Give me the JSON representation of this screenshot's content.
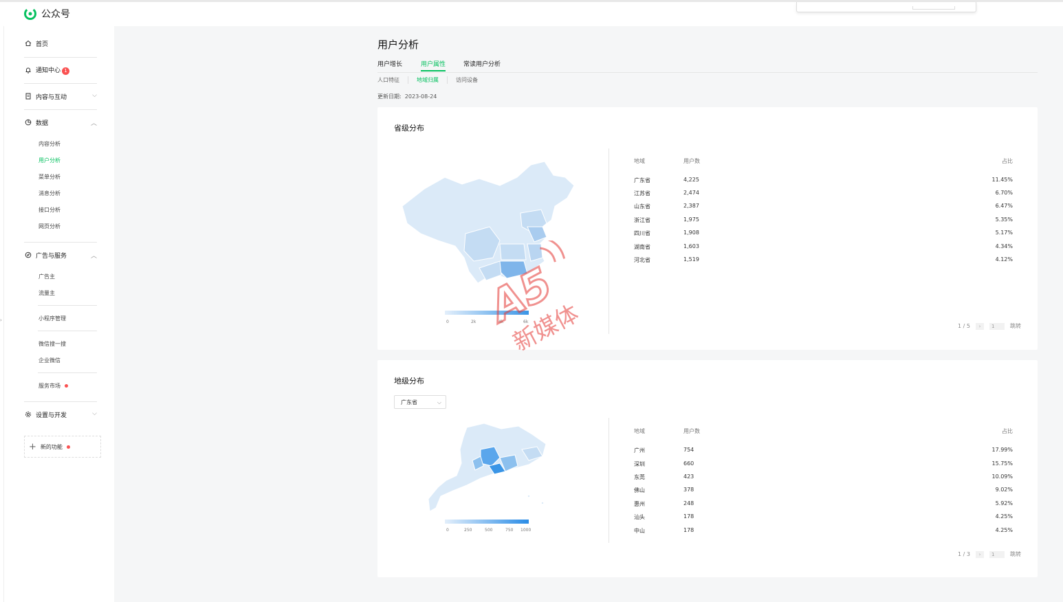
{
  "app": {
    "name": "公众号"
  },
  "sidebar": {
    "home": "首页",
    "notify": "通知中心",
    "notify_badge": "1",
    "content": "内容与互动",
    "data": "数据",
    "data_items": [
      "内容分析",
      "用户分析",
      "菜单分析",
      "消息分析",
      "接口分析",
      "网页分析"
    ],
    "data_active": "用户分析",
    "ads": "广告与服务",
    "ads_items": [
      "广告主",
      "流量主"
    ],
    "mini": "小程序管理",
    "search": "微信搜一搜",
    "wework": "企业微信",
    "market": "服务市场",
    "settings": "设置与开发",
    "newfunc": "新的功能"
  },
  "page": {
    "title": "用户分析",
    "tabs": [
      "用户增长",
      "用户属性",
      "常读用户分析"
    ],
    "active_tab": "用户属性",
    "subtabs": [
      "人口特征",
      "地域归属",
      "访问设备"
    ],
    "active_subtab": "地域归属",
    "update_label": "更新日期:",
    "update_date": "2023-08-24"
  },
  "province": {
    "title": "省级分布",
    "headers": {
      "region": "地域",
      "users": "用户数",
      "ratio": "占比"
    },
    "rows": [
      {
        "region": "广东省",
        "users": "4,225",
        "ratio": "11.45%"
      },
      {
        "region": "江苏省",
        "users": "2,474",
        "ratio": "6.70%"
      },
      {
        "region": "山东省",
        "users": "2,387",
        "ratio": "6.47%"
      },
      {
        "region": "浙江省",
        "users": "1,975",
        "ratio": "5.35%"
      },
      {
        "region": "四川省",
        "users": "1,908",
        "ratio": "5.17%"
      },
      {
        "region": "湖南省",
        "users": "1,603",
        "ratio": "4.34%"
      },
      {
        "region": "河北省",
        "users": "1,519",
        "ratio": "4.12%"
      }
    ],
    "legend": [
      "0",
      "2k",
      "4k",
      "6k"
    ],
    "pager": {
      "info": "1 / 5",
      "page": "1",
      "jump": "跳转"
    }
  },
  "city": {
    "title": "地级分布",
    "select_value": "广东省",
    "headers": {
      "region": "地域",
      "users": "用户数",
      "ratio": "占比"
    },
    "rows": [
      {
        "region": "广州",
        "users": "754",
        "ratio": "17.99%"
      },
      {
        "region": "深圳",
        "users": "660",
        "ratio": "15.75%"
      },
      {
        "region": "东莞",
        "users": "423",
        "ratio": "10.09%"
      },
      {
        "region": "佛山",
        "users": "378",
        "ratio": "9.02%"
      },
      {
        "region": "惠州",
        "users": "248",
        "ratio": "5.92%"
      },
      {
        "region": "汕头",
        "users": "178",
        "ratio": "4.25%"
      },
      {
        "region": "中山",
        "users": "178",
        "ratio": "4.25%"
      }
    ],
    "legend": [
      "0",
      "250",
      "500",
      "750",
      "1000"
    ],
    "pager": {
      "info": "1 / 3",
      "page": "1",
      "jump": "跳转"
    }
  },
  "watermark": {
    "brand": "A5",
    "text": "新媒体"
  },
  "colors": {
    "accent": "#07c160",
    "badge": "#fa5151",
    "map_light": "#dbeaf8",
    "map_dark": "#3a95e6"
  }
}
